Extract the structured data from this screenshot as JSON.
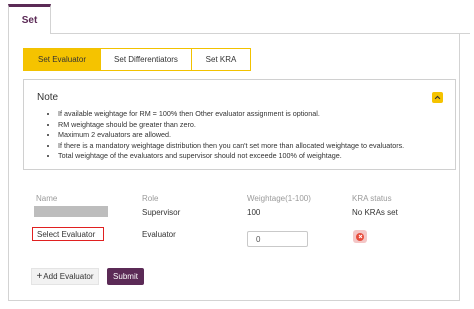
{
  "outer_tab": {
    "label": "Set"
  },
  "subtabs": [
    {
      "label": "Set Evaluator",
      "active": true
    },
    {
      "label": "Set Differentiators",
      "active": false
    },
    {
      "label": "Set KRA",
      "active": false
    }
  ],
  "note": {
    "title": "Note",
    "items": [
      "If available weightage for RM = 100% then Other evaluator assignment is optional.",
      "RM weightage should be greater than zero.",
      "Maximum 2 evaluators are allowed.",
      "If there is a mandatory weightage distribution then you can't set more than allocated weightage to evaluators.",
      "Total weightage of the evaluators and supervisor should not exceede 100% of weightage."
    ]
  },
  "table": {
    "headers": {
      "name": "Name",
      "role": "Role",
      "weightage": "Weightage(1-100)",
      "kra": "KRA status"
    },
    "supervisor_row": {
      "role": "Supervisor",
      "weightage": "100",
      "kra": "No KRAs set"
    },
    "evaluator_row": {
      "select_label": "Select Evaluator",
      "role": "Evaluator",
      "weightage_value": "0"
    }
  },
  "buttons": {
    "add_evaluator": "Add Evaluator",
    "submit": "Submit"
  },
  "colors": {
    "brand": "#5b2a56",
    "accent": "#f5c300",
    "highlight_border": "#e02020",
    "delete": "#e74c3c"
  }
}
